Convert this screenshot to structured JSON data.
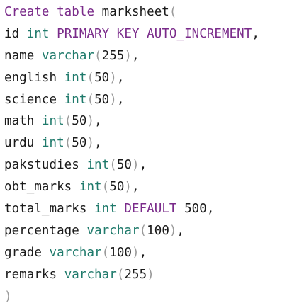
{
  "editor": {
    "lines": [
      {
        "parts": [
          {
            "t": "Create table",
            "c": "kw"
          },
          {
            "t": " marksheet",
            "c": "plain"
          },
          {
            "t": "(",
            "c": "par"
          }
        ]
      },
      {
        "parts": [
          {
            "t": "id",
            "c": "plain"
          },
          {
            "t": " ",
            "c": "plain"
          },
          {
            "t": "int",
            "c": "ty"
          },
          {
            "t": " PRIMARY KEY AUTO_INCREMENT",
            "c": "kw"
          },
          {
            "t": ",",
            "c": "pun"
          }
        ]
      },
      {
        "parts": [
          {
            "t": "name",
            "c": "plain"
          },
          {
            "t": " ",
            "c": "plain"
          },
          {
            "t": "varchar",
            "c": "ty"
          },
          {
            "t": "(",
            "c": "par"
          },
          {
            "t": "255",
            "c": "num"
          },
          {
            "t": ")",
            "c": "par"
          },
          {
            "t": ",",
            "c": "pun"
          }
        ]
      },
      {
        "parts": [
          {
            "t": "english",
            "c": "plain"
          },
          {
            "t": " ",
            "c": "plain"
          },
          {
            "t": "int",
            "c": "ty"
          },
          {
            "t": "(",
            "c": "par"
          },
          {
            "t": "50",
            "c": "num"
          },
          {
            "t": ")",
            "c": "par"
          },
          {
            "t": ",",
            "c": "pun"
          }
        ]
      },
      {
        "parts": [
          {
            "t": "science",
            "c": "plain"
          },
          {
            "t": " ",
            "c": "plain"
          },
          {
            "t": "int",
            "c": "ty"
          },
          {
            "t": "(",
            "c": "par"
          },
          {
            "t": "50",
            "c": "num"
          },
          {
            "t": ")",
            "c": "par"
          },
          {
            "t": ",",
            "c": "pun"
          }
        ]
      },
      {
        "parts": [
          {
            "t": "math",
            "c": "plain"
          },
          {
            "t": " ",
            "c": "plain"
          },
          {
            "t": "int",
            "c": "ty"
          },
          {
            "t": "(",
            "c": "par"
          },
          {
            "t": "50",
            "c": "num"
          },
          {
            "t": ")",
            "c": "par"
          },
          {
            "t": ",",
            "c": "pun"
          }
        ]
      },
      {
        "parts": [
          {
            "t": "urdu",
            "c": "plain"
          },
          {
            "t": " ",
            "c": "plain"
          },
          {
            "t": "int",
            "c": "ty"
          },
          {
            "t": "(",
            "c": "par"
          },
          {
            "t": "50",
            "c": "num"
          },
          {
            "t": ")",
            "c": "par"
          },
          {
            "t": ",",
            "c": "pun"
          }
        ]
      },
      {
        "parts": [
          {
            "t": "pakstudies",
            "c": "plain"
          },
          {
            "t": " ",
            "c": "plain"
          },
          {
            "t": "int",
            "c": "ty"
          },
          {
            "t": "(",
            "c": "par"
          },
          {
            "t": "50",
            "c": "num"
          },
          {
            "t": ")",
            "c": "par"
          },
          {
            "t": ",",
            "c": "pun"
          }
        ]
      },
      {
        "parts": [
          {
            "t": "obt_marks",
            "c": "plain"
          },
          {
            "t": " ",
            "c": "plain"
          },
          {
            "t": "int",
            "c": "ty"
          },
          {
            "t": "(",
            "c": "par"
          },
          {
            "t": "50",
            "c": "num"
          },
          {
            "t": ")",
            "c": "par"
          },
          {
            "t": ",",
            "c": "pun"
          }
        ]
      },
      {
        "parts": [
          {
            "t": "total_marks",
            "c": "plain"
          },
          {
            "t": " ",
            "c": "plain"
          },
          {
            "t": "int",
            "c": "ty"
          },
          {
            "t": " DEFAULT",
            "c": "kw"
          },
          {
            "t": " 500",
            "c": "num"
          },
          {
            "t": ",",
            "c": "pun"
          }
        ]
      },
      {
        "parts": [
          {
            "t": "percentage",
            "c": "plain"
          },
          {
            "t": " ",
            "c": "plain"
          },
          {
            "t": "varchar",
            "c": "ty"
          },
          {
            "t": "(",
            "c": "par"
          },
          {
            "t": "100",
            "c": "num"
          },
          {
            "t": ")",
            "c": "par"
          },
          {
            "t": ",",
            "c": "pun"
          }
        ]
      },
      {
        "parts": [
          {
            "t": "grade",
            "c": "plain"
          },
          {
            "t": " ",
            "c": "plain"
          },
          {
            "t": "varchar",
            "c": "ty"
          },
          {
            "t": "(",
            "c": "par"
          },
          {
            "t": "100",
            "c": "num"
          },
          {
            "t": ")",
            "c": "par"
          },
          {
            "t": ",",
            "c": "pun"
          }
        ]
      },
      {
        "parts": [
          {
            "t": "remarks",
            "c": "plain"
          },
          {
            "t": " ",
            "c": "plain"
          },
          {
            "t": "varchar",
            "c": "ty"
          },
          {
            "t": "(",
            "c": "par"
          },
          {
            "t": "255",
            "c": "num"
          },
          {
            "t": ")",
            "c": "par"
          }
        ]
      },
      {
        "parts": [
          {
            "t": ")",
            "c": "par"
          }
        ]
      }
    ],
    "colors": {
      "keyword": "#7a2b8a",
      "type": "#1f7a6b",
      "text": "#1a1a1a",
      "paren": "#9a9a9a",
      "background": "#ffffff"
    }
  }
}
